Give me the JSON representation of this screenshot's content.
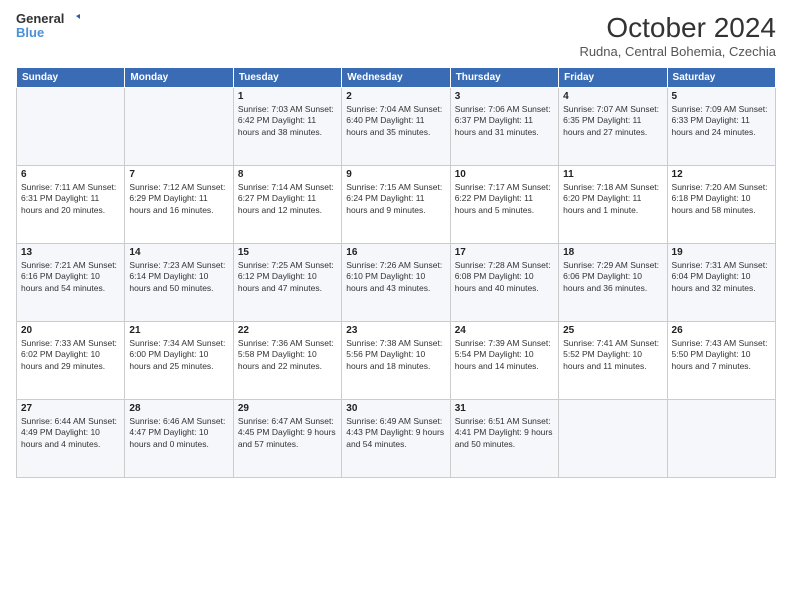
{
  "logo": {
    "line1": "General",
    "line2": "Blue"
  },
  "title": "October 2024",
  "subtitle": "Rudna, Central Bohemia, Czechia",
  "days_of_week": [
    "Sunday",
    "Monday",
    "Tuesday",
    "Wednesday",
    "Thursday",
    "Friday",
    "Saturday"
  ],
  "weeks": [
    [
      {
        "day": "",
        "info": ""
      },
      {
        "day": "",
        "info": ""
      },
      {
        "day": "1",
        "info": "Sunrise: 7:03 AM\nSunset: 6:42 PM\nDaylight: 11 hours and 38 minutes."
      },
      {
        "day": "2",
        "info": "Sunrise: 7:04 AM\nSunset: 6:40 PM\nDaylight: 11 hours and 35 minutes."
      },
      {
        "day": "3",
        "info": "Sunrise: 7:06 AM\nSunset: 6:37 PM\nDaylight: 11 hours and 31 minutes."
      },
      {
        "day": "4",
        "info": "Sunrise: 7:07 AM\nSunset: 6:35 PM\nDaylight: 11 hours and 27 minutes."
      },
      {
        "day": "5",
        "info": "Sunrise: 7:09 AM\nSunset: 6:33 PM\nDaylight: 11 hours and 24 minutes."
      }
    ],
    [
      {
        "day": "6",
        "info": "Sunrise: 7:11 AM\nSunset: 6:31 PM\nDaylight: 11 hours and 20 minutes."
      },
      {
        "day": "7",
        "info": "Sunrise: 7:12 AM\nSunset: 6:29 PM\nDaylight: 11 hours and 16 minutes."
      },
      {
        "day": "8",
        "info": "Sunrise: 7:14 AM\nSunset: 6:27 PM\nDaylight: 11 hours and 12 minutes."
      },
      {
        "day": "9",
        "info": "Sunrise: 7:15 AM\nSunset: 6:24 PM\nDaylight: 11 hours and 9 minutes."
      },
      {
        "day": "10",
        "info": "Sunrise: 7:17 AM\nSunset: 6:22 PM\nDaylight: 11 hours and 5 minutes."
      },
      {
        "day": "11",
        "info": "Sunrise: 7:18 AM\nSunset: 6:20 PM\nDaylight: 11 hours and 1 minute."
      },
      {
        "day": "12",
        "info": "Sunrise: 7:20 AM\nSunset: 6:18 PM\nDaylight: 10 hours and 58 minutes."
      }
    ],
    [
      {
        "day": "13",
        "info": "Sunrise: 7:21 AM\nSunset: 6:16 PM\nDaylight: 10 hours and 54 minutes."
      },
      {
        "day": "14",
        "info": "Sunrise: 7:23 AM\nSunset: 6:14 PM\nDaylight: 10 hours and 50 minutes."
      },
      {
        "day": "15",
        "info": "Sunrise: 7:25 AM\nSunset: 6:12 PM\nDaylight: 10 hours and 47 minutes."
      },
      {
        "day": "16",
        "info": "Sunrise: 7:26 AM\nSunset: 6:10 PM\nDaylight: 10 hours and 43 minutes."
      },
      {
        "day": "17",
        "info": "Sunrise: 7:28 AM\nSunset: 6:08 PM\nDaylight: 10 hours and 40 minutes."
      },
      {
        "day": "18",
        "info": "Sunrise: 7:29 AM\nSunset: 6:06 PM\nDaylight: 10 hours and 36 minutes."
      },
      {
        "day": "19",
        "info": "Sunrise: 7:31 AM\nSunset: 6:04 PM\nDaylight: 10 hours and 32 minutes."
      }
    ],
    [
      {
        "day": "20",
        "info": "Sunrise: 7:33 AM\nSunset: 6:02 PM\nDaylight: 10 hours and 29 minutes."
      },
      {
        "day": "21",
        "info": "Sunrise: 7:34 AM\nSunset: 6:00 PM\nDaylight: 10 hours and 25 minutes."
      },
      {
        "day": "22",
        "info": "Sunrise: 7:36 AM\nSunset: 5:58 PM\nDaylight: 10 hours and 22 minutes."
      },
      {
        "day": "23",
        "info": "Sunrise: 7:38 AM\nSunset: 5:56 PM\nDaylight: 10 hours and 18 minutes."
      },
      {
        "day": "24",
        "info": "Sunrise: 7:39 AM\nSunset: 5:54 PM\nDaylight: 10 hours and 14 minutes."
      },
      {
        "day": "25",
        "info": "Sunrise: 7:41 AM\nSunset: 5:52 PM\nDaylight: 10 hours and 11 minutes."
      },
      {
        "day": "26",
        "info": "Sunrise: 7:43 AM\nSunset: 5:50 PM\nDaylight: 10 hours and 7 minutes."
      }
    ],
    [
      {
        "day": "27",
        "info": "Sunrise: 6:44 AM\nSunset: 4:49 PM\nDaylight: 10 hours and 4 minutes."
      },
      {
        "day": "28",
        "info": "Sunrise: 6:46 AM\nSunset: 4:47 PM\nDaylight: 10 hours and 0 minutes."
      },
      {
        "day": "29",
        "info": "Sunrise: 6:47 AM\nSunset: 4:45 PM\nDaylight: 9 hours and 57 minutes."
      },
      {
        "day": "30",
        "info": "Sunrise: 6:49 AM\nSunset: 4:43 PM\nDaylight: 9 hours and 54 minutes."
      },
      {
        "day": "31",
        "info": "Sunrise: 6:51 AM\nSunset: 4:41 PM\nDaylight: 9 hours and 50 minutes."
      },
      {
        "day": "",
        "info": ""
      },
      {
        "day": "",
        "info": ""
      }
    ]
  ]
}
